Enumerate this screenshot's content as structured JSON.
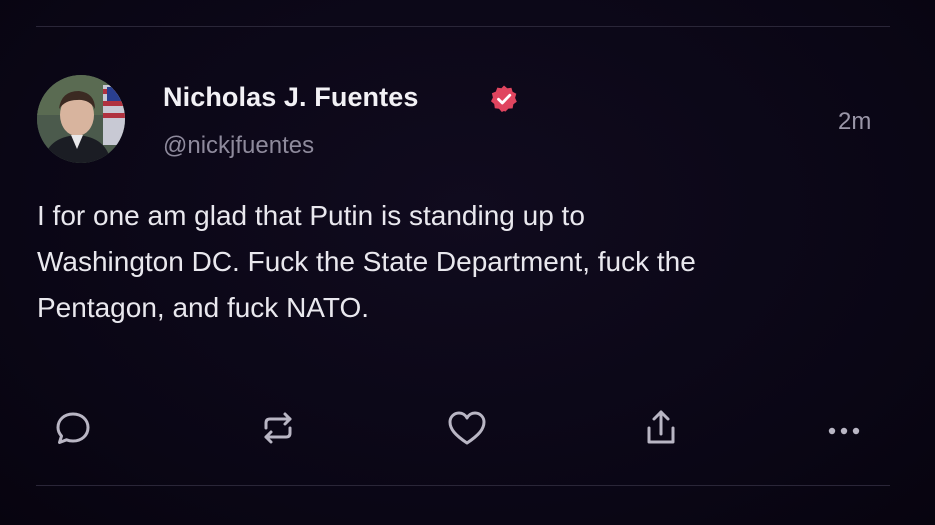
{
  "post": {
    "author_name": "Nicholas J. Fuentes",
    "handle": "@nickjfuentes",
    "timestamp": "2m",
    "verified": true,
    "text": "I for one am glad that Putin is standing up to\nWashington DC. Fuck the State Department, fuck the\nPentagon, and fuck NATO."
  },
  "actions": [
    {
      "icon": "reply-icon"
    },
    {
      "icon": "repost-icon"
    },
    {
      "icon": "like-icon"
    },
    {
      "icon": "share-icon"
    },
    {
      "icon": "more-icon"
    }
  ],
  "colors": {
    "background": "#0a0615",
    "text_primary": "#f2f1f5",
    "text_secondary": "#8e8a9c",
    "icon": "#b9b6c4",
    "verified_badge": "#e0455f"
  }
}
